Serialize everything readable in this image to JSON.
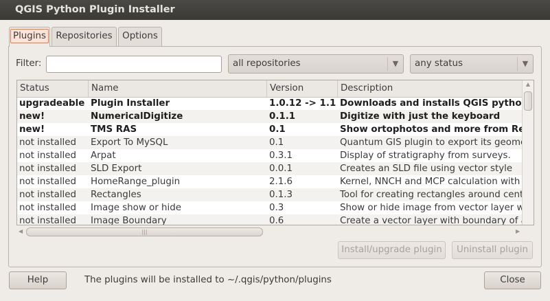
{
  "window": {
    "title": "QGIS Python Plugin Installer"
  },
  "tabs": [
    {
      "label": "Plugins"
    },
    {
      "label": "Repositories"
    },
    {
      "label": "Options"
    }
  ],
  "filter": {
    "label": "Filter:",
    "value": ""
  },
  "repo_select": {
    "value": "all repositories"
  },
  "status_select": {
    "value": "any status"
  },
  "table": {
    "columns": [
      "Status",
      "Name",
      "Version",
      "Description"
    ],
    "rows": [
      {
        "status": "upgradeable",
        "name": "Plugin Installer",
        "version": "1.0.12 -> 1.1",
        "description": "Downloads and installs QGIS python plugins"
      },
      {
        "status": "new!",
        "name": "NumericalDigitize",
        "version": "0.1.1",
        "description": "Digitize with just the keyboard"
      },
      {
        "status": "new!",
        "name": "TMS RAS",
        "version": "0.1",
        "description": "Show ortophotos and more from Re"
      },
      {
        "status": "not installed",
        "name": "Export To MySQL",
        "version": "0.1",
        "description": "Quantum GIS plugin to export its geometries"
      },
      {
        "status": "not installed",
        "name": "Arpat",
        "version": "0.3.1",
        "description": "Display of stratigraphy from surveys."
      },
      {
        "status": "not installed",
        "name": "SLD Export",
        "version": "0.0.1",
        "description": "Creates an SLD file using vector style"
      },
      {
        "status": "not installed",
        "name": "HomeRange_plugin",
        "version": "2.1.6",
        "description": "Kernel, NNCH and MCP calculation with R"
      },
      {
        "status": "not installed",
        "name": "Rectangles",
        "version": "0.1.3",
        "description": "Tool for creating rectangles around centers"
      },
      {
        "status": "not installed",
        "name": "Image show or hide",
        "version": "0.3",
        "description": "Show or hide image from vector layer with"
      },
      {
        "status": "not installed",
        "name": "Image Boundary",
        "version": "0.6",
        "description": "Create a vector layer with boundary of all"
      }
    ]
  },
  "buttons": {
    "install": "Install/upgrade plugin",
    "uninstall": "Uninstall plugin",
    "help": "Help",
    "close": "Close"
  },
  "footer": {
    "message": "The plugins will be installed to ~/.qgis/python/plugins"
  }
}
